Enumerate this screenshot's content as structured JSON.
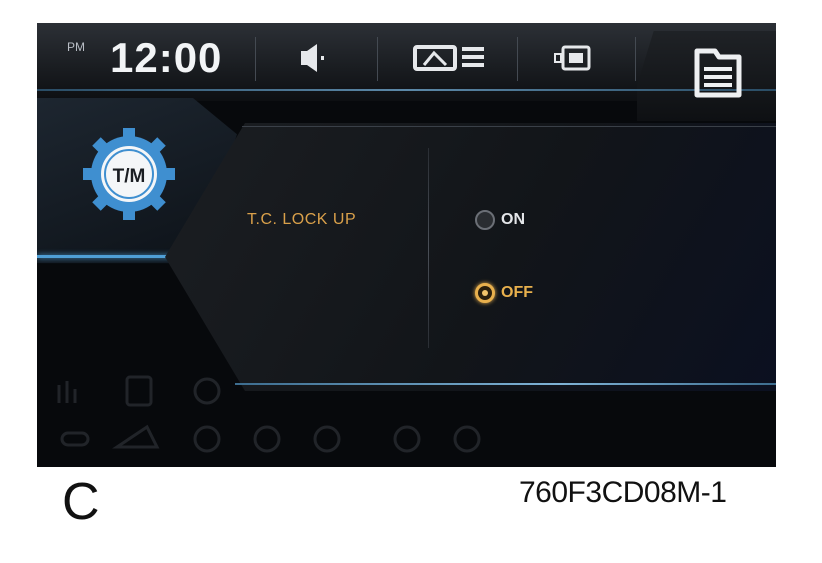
{
  "status_bar": {
    "ampm": "PM",
    "time": "12:00",
    "icons": [
      "speaker-icon",
      "display-brightness-icon",
      "screen-mode-icon",
      "menu-icon"
    ]
  },
  "category": {
    "icon": "transmission-gear-icon",
    "label": "T/M"
  },
  "setting": {
    "label": "T.C. LOCK UP",
    "options": [
      {
        "label": "ON",
        "selected": false
      },
      {
        "label": "OFF",
        "selected": true
      }
    ]
  },
  "colors": {
    "accent_orange": "#e8b04d",
    "accent_blue": "#4f9fd6",
    "label_orange": "#d9a04a"
  },
  "caption": {
    "letter": "C",
    "code": "760F3CD08M-1"
  }
}
